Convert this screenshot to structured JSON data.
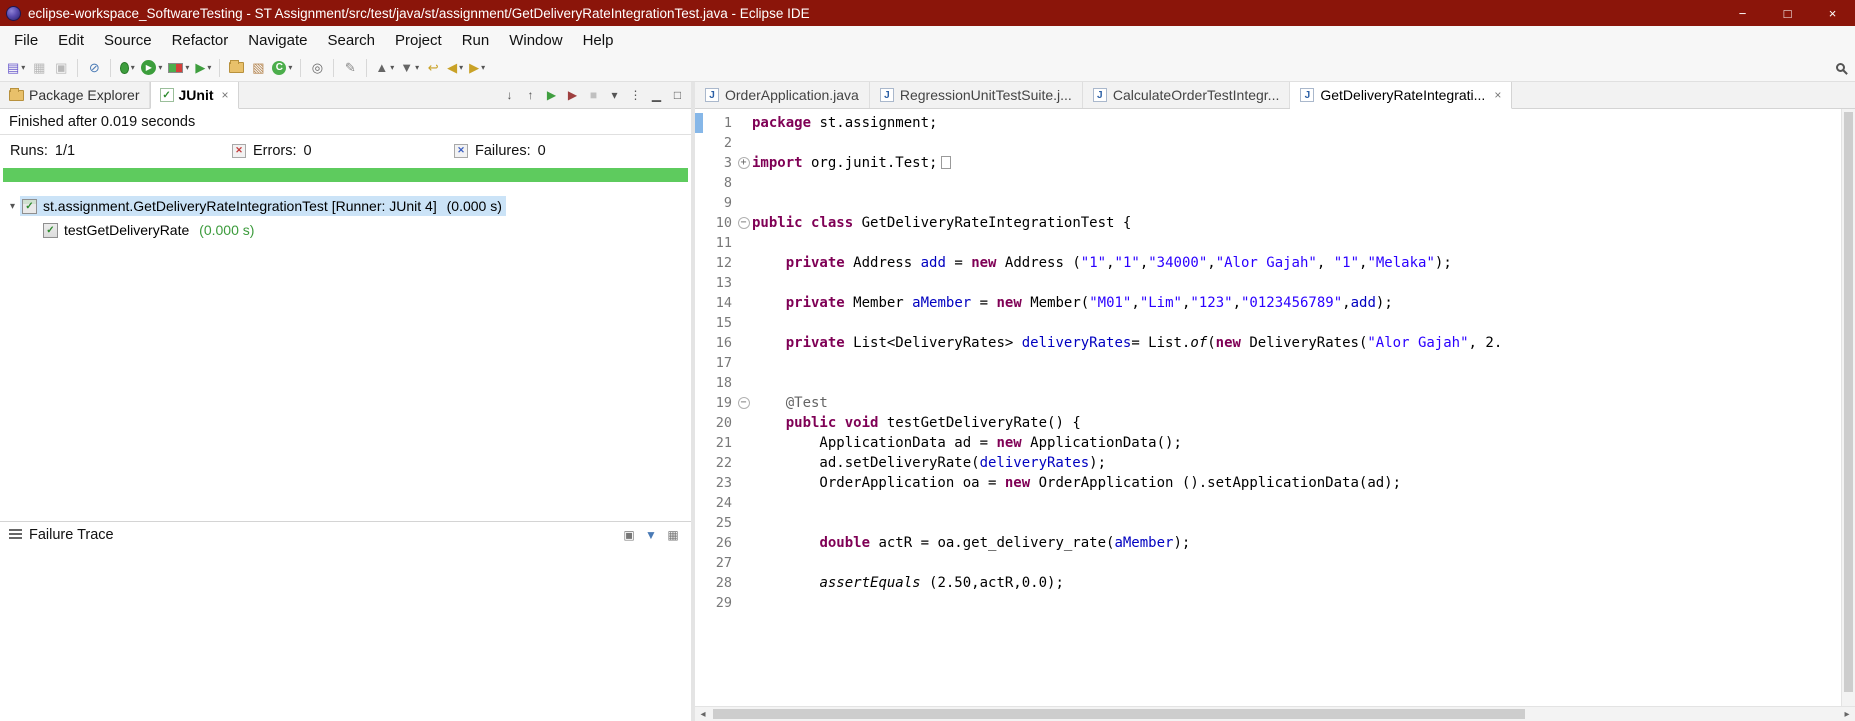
{
  "titlebar": {
    "title": "eclipse-workspace_SoftwareTesting - ST Assignment/src/test/java/st/assignment/GetDeliveryRateIntegrationTest.java - Eclipse IDE",
    "controls": {
      "minimize": "−",
      "maximize": "□",
      "close": "×"
    }
  },
  "menubar": [
    "File",
    "Edit",
    "Source",
    "Refactor",
    "Navigate",
    "Search",
    "Project",
    "Run",
    "Window",
    "Help"
  ],
  "toolbar": {
    "items": [
      {
        "name": "new-wizard-icon",
        "glyph": "▤",
        "color": "#6a5acd",
        "dd": true
      },
      {
        "name": "save-icon",
        "glyph": "▦",
        "color": "#b9b9b9"
      },
      {
        "name": "save-all-icon",
        "glyph": "▣",
        "color": "#b9b9b9"
      },
      {
        "sep": true
      },
      {
        "name": "skip-breakpoints-icon",
        "glyph": "⊘",
        "color": "#4a7ab5"
      },
      {
        "sep": true
      },
      {
        "name": "debug-icon",
        "glyph": "",
        "cls": "bug",
        "dd": true
      },
      {
        "name": "run-icon",
        "glyph": "▶",
        "cls": "run-circle",
        "dd": true
      },
      {
        "name": "coverage-icon",
        "glyph": "",
        "cls": "coverage",
        "dd": true
      },
      {
        "name": "run-external-tools-icon",
        "glyph": "▶",
        "color": "#3f9e3f",
        "dd": true
      },
      {
        "sep": true
      },
      {
        "name": "new-java-project-icon",
        "glyph": "",
        "cls": "folder-ic"
      },
      {
        "name": "new-package-icon",
        "glyph": "▧",
        "color": "#b5854f"
      },
      {
        "name": "new-class-icon",
        "glyph": "C",
        "cls": "class-circle",
        "dd": true
      },
      {
        "sep": true
      },
      {
        "name": "open-search-dialog-icon",
        "glyph": "◎",
        "color": "#666"
      },
      {
        "sep": true
      },
      {
        "name": "mark-occurrences-icon",
        "glyph": "✎",
        "color": "#888"
      },
      {
        "sep": true
      },
      {
        "name": "previous-annotation-icon",
        "glyph": "▲",
        "color": "#666",
        "dd": true
      },
      {
        "name": "next-annotation-icon",
        "glyph": "▼",
        "color": "#666",
        "dd": true
      },
      {
        "name": "last-edit-location-icon",
        "glyph": "↩",
        "color": "#c9a227"
      },
      {
        "name": "back-icon",
        "glyph": "◀",
        "color": "#c9a227",
        "dd": true
      },
      {
        "name": "forward-icon",
        "glyph": "▶",
        "color": "#c9a227",
        "dd": true
      }
    ]
  },
  "junit_view": {
    "tabs": [
      {
        "label": "Package Explorer",
        "active": false,
        "icon": "folder"
      },
      {
        "label": "JUnit",
        "active": true,
        "icon": "junit"
      }
    ],
    "view_toolbar": [
      {
        "name": "next-failed-test-icon",
        "glyph": "↓",
        "color": "#555"
      },
      {
        "name": "previous-failed-test-icon",
        "glyph": "↑",
        "color": "#555"
      },
      {
        "name": "rerun-test-icon",
        "glyph": "▶",
        "color": "#3f9e3f"
      },
      {
        "name": "rerun-failed-first-icon",
        "glyph": "▶",
        "color": "#9e3f3f"
      },
      {
        "name": "stop-test-icon",
        "glyph": "■",
        "color": "#c0c0c0"
      },
      {
        "name": "test-run-history-icon",
        "glyph": "▾",
        "color": "#555"
      },
      {
        "name": "view-menu-icon",
        "glyph": "⋮",
        "color": "#555"
      },
      {
        "name": "minimize-view-icon",
        "glyph": "▁",
        "color": "#555"
      },
      {
        "name": "maximize-view-icon",
        "glyph": "□",
        "color": "#555"
      }
    ],
    "finished_text": "Finished after 0.019 seconds",
    "runs_label": "Runs:",
    "runs_value": "1/1",
    "errors_label": "Errors:",
    "errors_value": "0",
    "failures_label": "Failures:",
    "failures_value": "0",
    "tree": [
      {
        "level": 0,
        "selected": true,
        "expanded": true,
        "icon": "suite-ok",
        "label": "st.assignment.GetDeliveryRateIntegrationTest [Runner: JUnit 4]",
        "time": " (0.000 s)"
      },
      {
        "level": 1,
        "selected": false,
        "icon": "test-ok",
        "label": "testGetDeliveryRate",
        "time": " (0.000 s)"
      }
    ],
    "failure_trace_label": "Failure Trace",
    "trace_icons": [
      {
        "name": "show-stack-trace-in-console-icon",
        "glyph": "▣",
        "color": "#777"
      },
      {
        "name": "filter-stack-trace-icon",
        "glyph": "▼",
        "color": "#4a7ab5"
      },
      {
        "name": "compare-result-icon",
        "glyph": "▦",
        "color": "#777"
      }
    ]
  },
  "editor": {
    "tabs": [
      {
        "label": "OrderApplication.java",
        "active": false
      },
      {
        "label": "RegressionUnitTestSuite.j...",
        "active": false
      },
      {
        "label": "CalculateOrderTestIntegr...",
        "active": false
      },
      {
        "label": "GetDeliveryRateIntegrati...",
        "active": true
      }
    ],
    "code_lines": [
      {
        "n": "1",
        "marker": true,
        "seg": [
          [
            "kw",
            "package"
          ],
          [
            "pl",
            " st.assignment;"
          ]
        ]
      },
      {
        "n": "2",
        "seg": []
      },
      {
        "n": "3",
        "fold": "plus",
        "seg": [
          [
            "kw",
            "import"
          ],
          [
            "pl",
            " org.junit.Test;"
          ],
          [
            "box",
            ""
          ]
        ]
      },
      {
        "n": "8",
        "seg": []
      },
      {
        "n": "9",
        "seg": []
      },
      {
        "n": "10",
        "fold": "minus",
        "seg": [
          [
            "kw",
            "public"
          ],
          [
            "pl",
            " "
          ],
          [
            "kw",
            "class"
          ],
          [
            "pl",
            " GetDeliveryRateIntegrationTest {"
          ]
        ]
      },
      {
        "n": "11",
        "seg": []
      },
      {
        "n": "12",
        "seg": [
          [
            "pl",
            "    "
          ],
          [
            "kw",
            "private"
          ],
          [
            "pl",
            " Address "
          ],
          [
            "fld",
            "add"
          ],
          [
            "pl",
            " = "
          ],
          [
            "kw",
            "new"
          ],
          [
            "pl",
            " Address ("
          ],
          [
            "str",
            "\"1\""
          ],
          [
            "pl",
            ","
          ],
          [
            "str",
            "\"1\""
          ],
          [
            "pl",
            ","
          ],
          [
            "str",
            "\"34000\""
          ],
          [
            "pl",
            ","
          ],
          [
            "str",
            "\"Alor Gajah\""
          ],
          [
            "pl",
            ", "
          ],
          [
            "str",
            "\"1\""
          ],
          [
            "pl",
            ","
          ],
          [
            "str",
            "\"Melaka\""
          ],
          [
            "pl",
            ");"
          ]
        ]
      },
      {
        "n": "13",
        "seg": []
      },
      {
        "n": "14",
        "seg": [
          [
            "pl",
            "    "
          ],
          [
            "kw",
            "private"
          ],
          [
            "pl",
            " Member "
          ],
          [
            "fld",
            "aMember"
          ],
          [
            "pl",
            " = "
          ],
          [
            "kw",
            "new"
          ],
          [
            "pl",
            " Member("
          ],
          [
            "str",
            "\"M01\""
          ],
          [
            "pl",
            ","
          ],
          [
            "str",
            "\"Lim\""
          ],
          [
            "pl",
            ","
          ],
          [
            "str",
            "\"123\""
          ],
          [
            "pl",
            ","
          ],
          [
            "str",
            "\"0123456789\""
          ],
          [
            "pl",
            ","
          ],
          [
            "fld",
            "add"
          ],
          [
            "pl",
            ");"
          ]
        ]
      },
      {
        "n": "15",
        "seg": []
      },
      {
        "n": "16",
        "seg": [
          [
            "pl",
            "    "
          ],
          [
            "kw",
            "private"
          ],
          [
            "pl",
            " List<DeliveryRates> "
          ],
          [
            "fld",
            "deliveryRates"
          ],
          [
            "pl",
            "= List."
          ],
          [
            "stx",
            "of"
          ],
          [
            "pl",
            "("
          ],
          [
            "kw",
            "new"
          ],
          [
            "pl",
            " DeliveryRates("
          ],
          [
            "str",
            "\"Alor Gajah\""
          ],
          [
            "pl",
            ", 2."
          ]
        ]
      },
      {
        "n": "17",
        "seg": []
      },
      {
        "n": "18",
        "seg": []
      },
      {
        "n": "19",
        "fold": "minus",
        "seg": [
          [
            "pl",
            "    "
          ],
          [
            "ann",
            "@Test"
          ]
        ]
      },
      {
        "n": "20",
        "seg": [
          [
            "pl",
            "    "
          ],
          [
            "kw",
            "public"
          ],
          [
            "pl",
            " "
          ],
          [
            "kw",
            "void"
          ],
          [
            "pl",
            " testGetDeliveryRate() {"
          ]
        ]
      },
      {
        "n": "21",
        "seg": [
          [
            "pl",
            "        ApplicationData ad = "
          ],
          [
            "kw",
            "new"
          ],
          [
            "pl",
            " ApplicationData();"
          ]
        ]
      },
      {
        "n": "22",
        "seg": [
          [
            "pl",
            "        ad.setDeliveryRate("
          ],
          [
            "fld",
            "deliveryRates"
          ],
          [
            "pl",
            ");"
          ]
        ]
      },
      {
        "n": "23",
        "seg": [
          [
            "pl",
            "        OrderApplication oa = "
          ],
          [
            "kw",
            "new"
          ],
          [
            "pl",
            " OrderApplication ().setApplicationData(ad);"
          ]
        ]
      },
      {
        "n": "24",
        "seg": []
      },
      {
        "n": "25",
        "seg": []
      },
      {
        "n": "26",
        "seg": [
          [
            "pl",
            "        "
          ],
          [
            "kw",
            "double"
          ],
          [
            "pl",
            " actR = oa.get_delivery_rate("
          ],
          [
            "fld",
            "aMember"
          ],
          [
            "pl",
            ");"
          ]
        ]
      },
      {
        "n": "27",
        "seg": []
      },
      {
        "n": "28",
        "seg": [
          [
            "pl",
            "        "
          ],
          [
            "stx",
            "assertEquals"
          ],
          [
            "pl",
            " (2.50,actR,0.0);"
          ]
        ]
      },
      {
        "n": "29",
        "seg": []
      }
    ]
  },
  "icons": {
    "java_file": "J",
    "junit_check": "✓",
    "close": "×",
    "expander": "▾",
    "fold_expand": "+",
    "fold_collapse": "−",
    "hscroll_left": "◂",
    "hscroll_right": "▸"
  },
  "colors": {
    "title_bg": "#8b150a",
    "green": "#5ecb5e",
    "kw": "#7f0055",
    "str": "#2a00ff",
    "fld": "#0000c0",
    "sel": "#cbe3f7"
  }
}
